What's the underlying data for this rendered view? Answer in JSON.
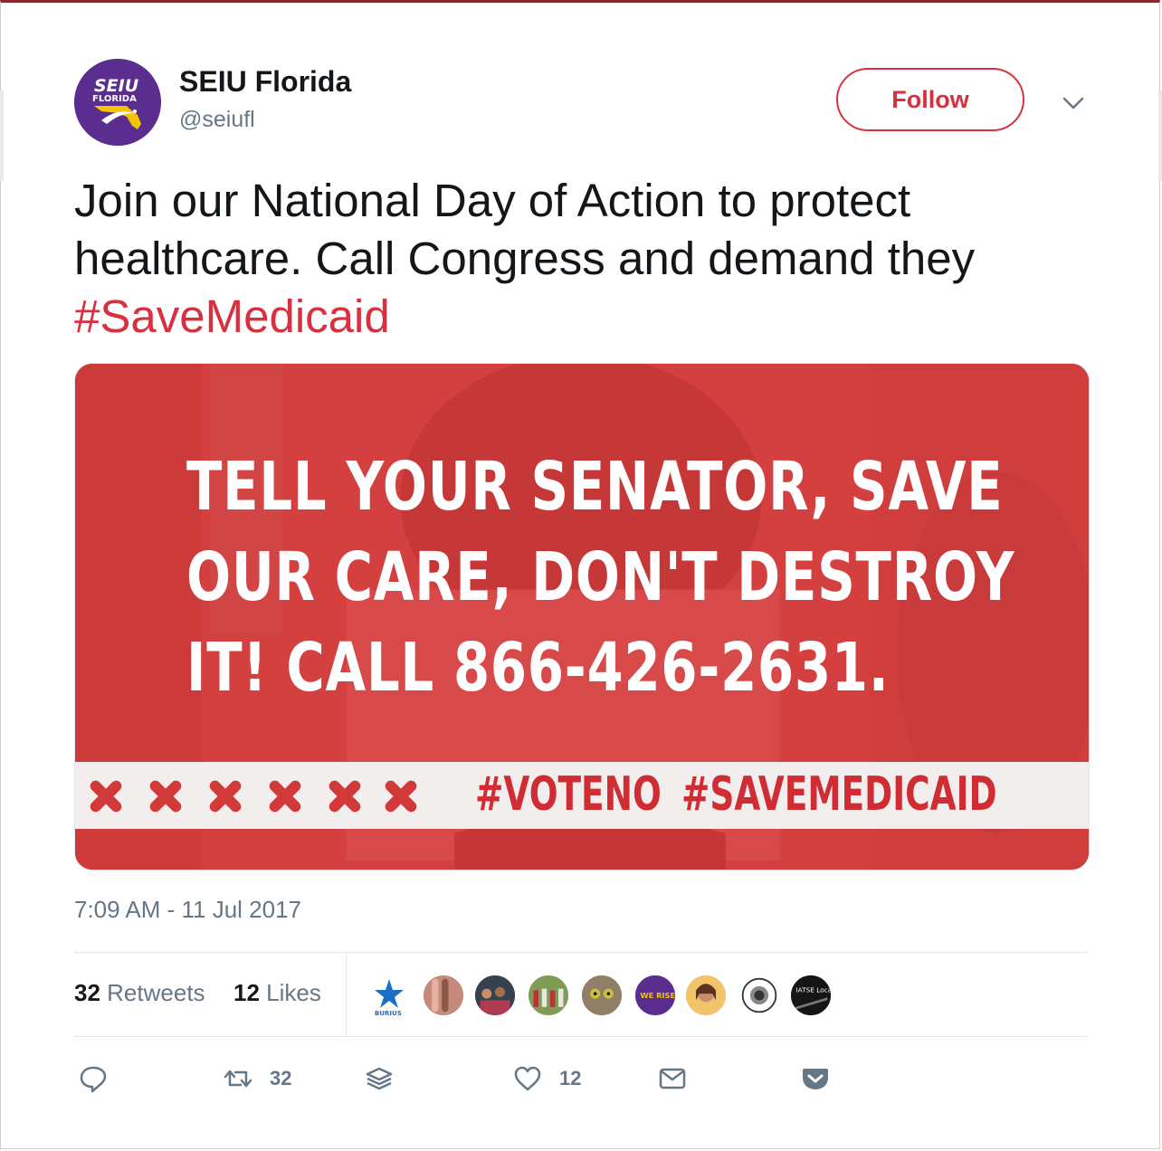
{
  "profile": {
    "name": "SEIU Florida",
    "handle": "@seiufl",
    "avatar_text_top": "SEIU",
    "avatar_text_sub": "FLORIDA"
  },
  "follow_label": "Follow",
  "tweet": {
    "text_before": "Join our National Day of Action to protect healthcare. Call Congress and demand they ",
    "hashtag": "#SaveMedicaid"
  },
  "media": {
    "line1": "TELL YOUR SENATOR, SAVE",
    "line2": "OUR CARE, DON'T DESTROY",
    "line3": "IT! CALL 866-426-2631.",
    "tag1": "#VOTENO",
    "tag2": "#SAVEMEDICAID",
    "colors": {
      "overlay": "#d44040",
      "band": "#f3eeee",
      "band_text": "#cf2d33"
    }
  },
  "timestamp": "7:09 AM - 11 Jul 2017",
  "stats": {
    "retweets_count": "32",
    "retweets_label": "Retweets",
    "likes_count": "12",
    "likes_label": "Likes"
  },
  "likers": [
    {
      "name": "burius-avatar",
      "text": "BURIUS"
    },
    {
      "name": "hands-avatar",
      "text": ""
    },
    {
      "name": "group-avatar",
      "text": ""
    },
    {
      "name": "crowd-avatar",
      "text": ""
    },
    {
      "name": "cat-avatar",
      "text": ""
    },
    {
      "name": "we-rise-avatar",
      "text": "WE RISE"
    },
    {
      "name": "woman-avatar",
      "text": ""
    },
    {
      "name": "seal-avatar",
      "text": ""
    },
    {
      "name": "iatse-avatar",
      "text": "IATSE Local"
    }
  ],
  "actions": {
    "reply_icon": "reply-icon",
    "retweet_count": "32",
    "like_count": "12"
  },
  "accent_color": "#d9303f"
}
